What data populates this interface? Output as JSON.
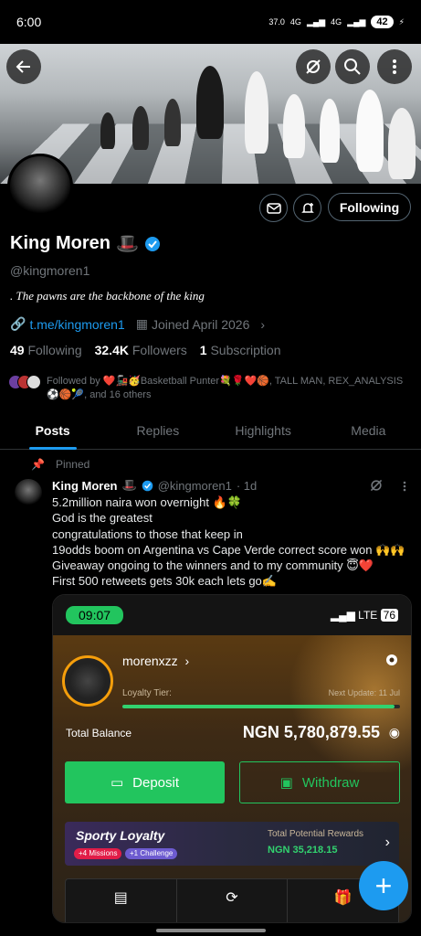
{
  "status_bar": {
    "time": "6:00",
    "speed": "37.0\nKB/S",
    "net1": "4G",
    "net2": "4G",
    "battery": "42"
  },
  "profile": {
    "name": "King Moren",
    "name_emoji": "🎩",
    "handle": "@kingmoren1",
    "bio": ".  The pawns are the backbone of the king",
    "link": "t.me/kingmoren1",
    "joined": "Joined April 2026",
    "following_count": "49",
    "following_label": "Following",
    "followers_count": "32.4K",
    "followers_label": "Followers",
    "subs_count": "1",
    "subs_label": "Subscription",
    "followed_by": "Followed by ❤️🚂🥳Basketball Punter💐🌹❤️🏀, TALL MAN, REX_ANALYSIS⚽🏀🎾, and 16 others",
    "follow_button": "Following"
  },
  "tabs": [
    {
      "label": "Posts"
    },
    {
      "label": "Replies"
    },
    {
      "label": "Highlights"
    },
    {
      "label": "Media"
    }
  ],
  "post": {
    "pinned_label": "Pinned",
    "author": "King Moren",
    "author_emoji": "🎩",
    "handle": "@kingmoren1",
    "time": "· 1d",
    "text": "5.2million naira won overnight 🔥🍀\nGod is the greatest\ncongratulations to those that keep in\n19odds boom on Argentina vs Cape Verde correct score won 🙌🙌\nGiveaway ongoing to the winners and to my community 😇❤️\nFirst 500 retweets gets 30k each lets go✍️"
  },
  "screenshot": {
    "time": "09:07",
    "signal": "LTE",
    "battery": "76",
    "username": "morenxzz",
    "loyalty_label": "Loyalty Tier:",
    "next_update": "Next Update: 11 Jul",
    "loyalty_progress": 0.98,
    "total_balance_label": "Total Balance",
    "amount": "NGN 5,780,879.55",
    "deposit": "Deposit",
    "withdraw": "Withdraw",
    "sporty_title": "Sporty Loyalty",
    "missions": "+4 Missions",
    "challenge": "+1 Challenge",
    "rewards_label": "Total Potential Rewards",
    "rewards_amount": "NGN 35,218.15",
    "bottom_row": [
      "Sporty Bet",
      "Transactions",
      "Gifts (2)"
    ]
  },
  "colors": {
    "accent": "#1d9bf0",
    "green": "#22c55e"
  }
}
